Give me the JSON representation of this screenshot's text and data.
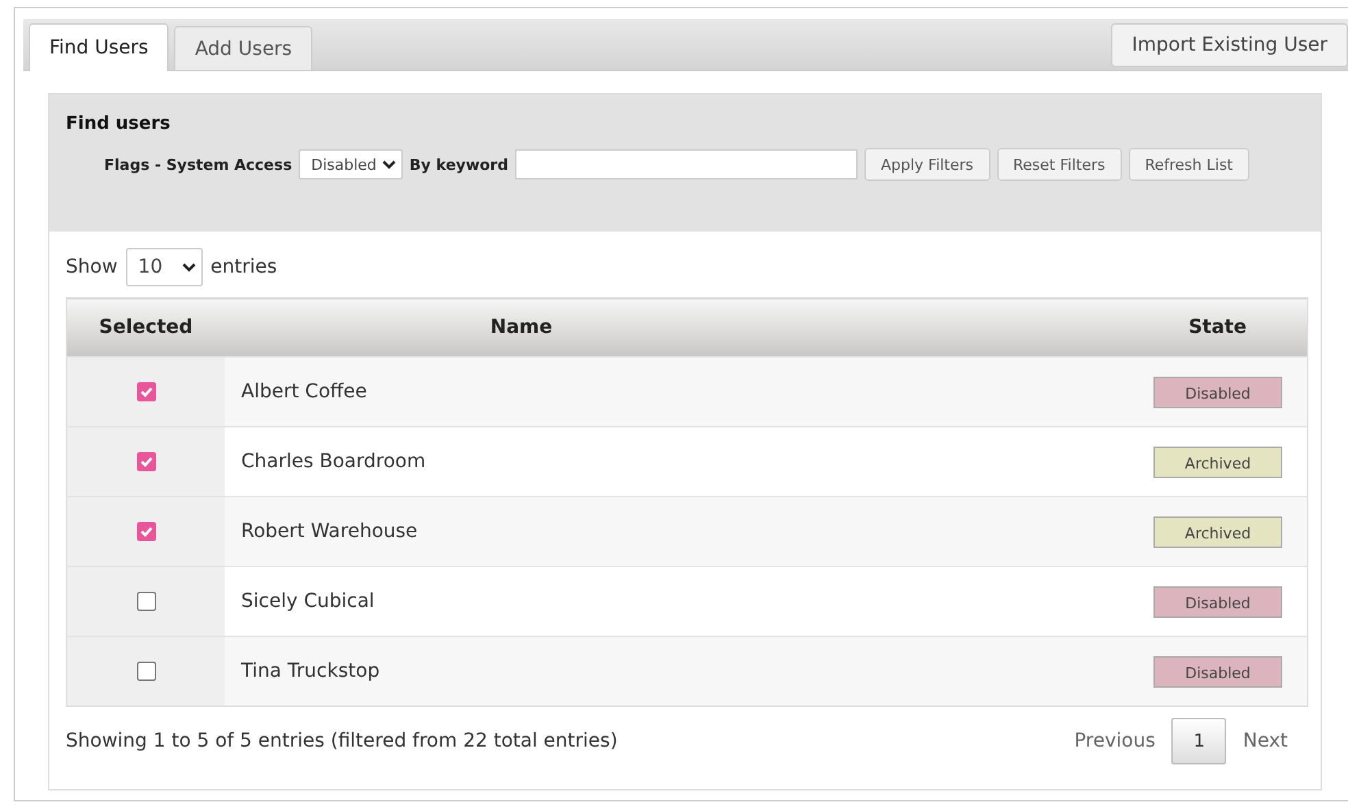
{
  "tabs": [
    {
      "label": "Find Users",
      "selected": true
    },
    {
      "label": "Add Users",
      "selected": false
    }
  ],
  "import_button": "Import Existing User",
  "filters": {
    "title": "Find users",
    "flags_label": "Flags - System Access",
    "flags_value": "Disabled",
    "keyword_label": "By keyword",
    "buttons": [
      "Apply Filters",
      "Reset Filters",
      "Refresh List"
    ]
  },
  "length": {
    "before": "Show",
    "value": "10",
    "after": "entries"
  },
  "table": {
    "columns": [
      "Selected",
      "Name",
      "State"
    ],
    "rows": [
      {
        "checked": true,
        "name": "Albert Coffee",
        "state": "Disabled",
        "color": "#dcb4bd"
      },
      {
        "checked": true,
        "name": "Charles Boardroom",
        "state": "Archived",
        "color": "#e4e4c0"
      },
      {
        "checked": true,
        "name": "Robert Warehouse",
        "state": "Archived",
        "color": "#e4e4c0"
      },
      {
        "checked": false,
        "name": "Sicely Cubical",
        "state": "Disabled",
        "color": "#dcb4bd"
      },
      {
        "checked": false,
        "name": "Tina Truckstop",
        "state": "Disabled",
        "color": "#dcb4bd"
      }
    ]
  },
  "info": "Showing 1 to 5 of 5 entries (filtered from 22 total entries)",
  "pagination": {
    "previous": "Previous",
    "pages": [
      {
        "label": "1",
        "selected": true
      }
    ],
    "next": "Next"
  }
}
